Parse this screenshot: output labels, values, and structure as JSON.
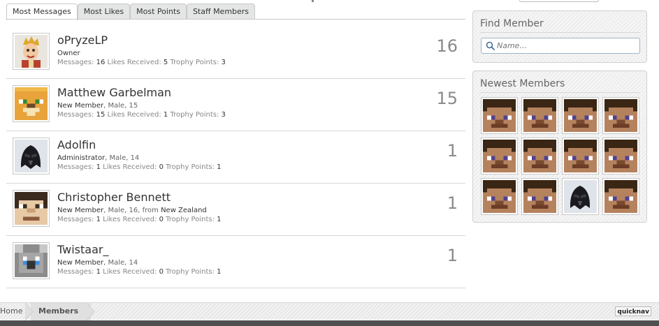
{
  "tabs": [
    {
      "label": "Most Messages",
      "active": true
    },
    {
      "label": "Most Likes",
      "active": false
    },
    {
      "label": "Most Points",
      "active": false
    },
    {
      "label": "Staff Members",
      "active": false
    }
  ],
  "labels": {
    "messages": "Messages:",
    "likes": "Likes Received:",
    "trophy": "Trophy Points:"
  },
  "members": [
    {
      "name": "oPryzeLP",
      "role": "Owner",
      "extra": "",
      "messages": "16",
      "likes": "5",
      "trophy": "3",
      "count": "16",
      "avatar": "character-avatar"
    },
    {
      "name": "Matthew Garbelman",
      "role": "New Member",
      "extra": ", Male, 15",
      "messages": "15",
      "likes": "1",
      "trophy": "3",
      "count": "15",
      "avatar": "ocelot-avatar"
    },
    {
      "name": "Adolfin",
      "role": "Administrator",
      "extra": ", Male, 14",
      "messages": "1",
      "likes": "0",
      "trophy": "1",
      "count": "1",
      "avatar": "dark-helmet-avatar"
    },
    {
      "name": "Christopher Bennett",
      "role": "New Member",
      "extra": ", Male, 16, ",
      "location_prefix": "from ",
      "location": "New Zealand",
      "messages": "1",
      "likes": "0",
      "trophy": "1",
      "count": "1",
      "avatar": "pixel-face-avatar"
    },
    {
      "name": "Twistaar_",
      "role": "New Member",
      "extra": ", Male, 14",
      "messages": "1",
      "likes": "0",
      "trophy": "1",
      "count": "1",
      "avatar": "koala-avatar"
    }
  ],
  "sidebar": {
    "find_member": {
      "heading": "Find Member",
      "placeholder": "Name..."
    },
    "newest_members": {
      "heading": "Newest Members",
      "avatars": [
        "steve",
        "steve",
        "steve",
        "steve",
        "steve",
        "steve",
        "steve",
        "steve",
        "steve",
        "steve",
        "dark-helmet",
        "steve"
      ]
    }
  },
  "breadcrumb": {
    "home": "Home",
    "current": "Members",
    "quicknav": "quicknav"
  },
  "colors": {
    "accent_border": "#9fb2c8",
    "count_gray": "#8a8a8a"
  }
}
